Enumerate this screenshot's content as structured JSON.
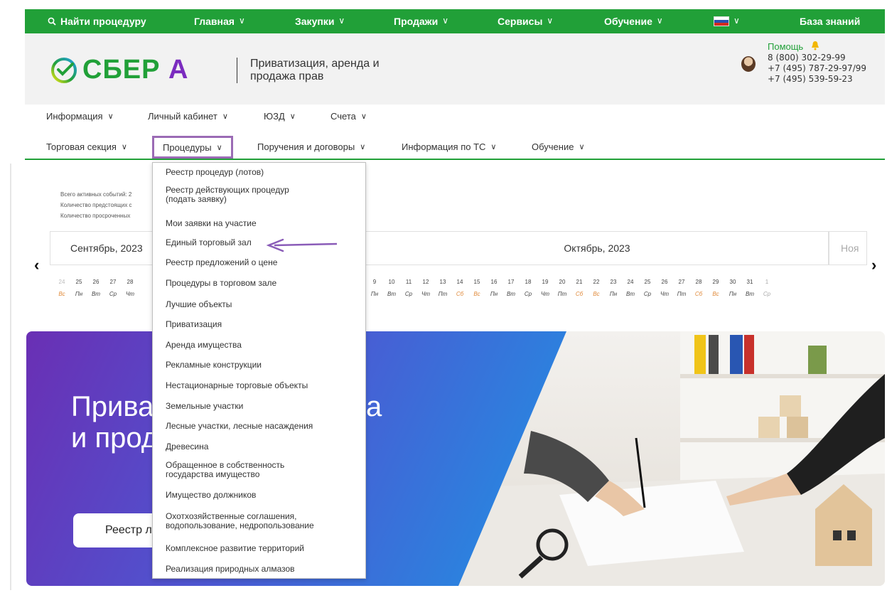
{
  "topbar": {
    "find_label": "Найти процедуру",
    "items": [
      "Главная",
      "Закупки",
      "Продажи",
      "Сервисы",
      "Обучение"
    ],
    "knowledge": "База знаний",
    "color": "#21a038"
  },
  "header": {
    "logo": "СБЕР",
    "logo_a": "А",
    "tagline_1": "Приватизация, аренда и",
    "tagline_2": "продажа прав",
    "help": {
      "label": "Помощь",
      "phone1": "8 (800) 302-29-99",
      "phone2": "+7 (495) 787-29-97/99",
      "phone3": "+7 (495) 539-59-23"
    }
  },
  "menu1": [
    "Информация",
    "Личный кабинет",
    "ЮЗД",
    "Счета"
  ],
  "menu2": [
    "Торговая секция",
    "Процедуры",
    "Поручения и договоры",
    "Информация по ТС",
    "Обучение"
  ],
  "events": {
    "line1": "Всего активных событий: 2",
    "line2": "Количество предстоящих с",
    "line3": "Количество просроченных"
  },
  "calendar": {
    "sept": "Сентябрь, 2023",
    "oct": "Октябрь, 2023",
    "nov": "Ноя",
    "left_days": [
      {
        "n": "24",
        "w": "Вс"
      },
      {
        "n": "25",
        "w": "Пн"
      },
      {
        "n": "26",
        "w": "Вт"
      },
      {
        "n": "27",
        "w": "Ср"
      },
      {
        "n": "28",
        "w": "Чт"
      }
    ],
    "right_days": [
      {
        "n": "9",
        "w": "Пн"
      },
      {
        "n": "10",
        "w": "Вт"
      },
      {
        "n": "11",
        "w": "Ср"
      },
      {
        "n": "12",
        "w": "Чт"
      },
      {
        "n": "13",
        "w": "Пт"
      },
      {
        "n": "14",
        "w": "Сб"
      },
      {
        "n": "15",
        "w": "Вс"
      },
      {
        "n": "16",
        "w": "Пн"
      },
      {
        "n": "17",
        "w": "Вт"
      },
      {
        "n": "18",
        "w": "Ср"
      },
      {
        "n": "19",
        "w": "Чт"
      },
      {
        "n": "20",
        "w": "Пт"
      },
      {
        "n": "21",
        "w": "Сб"
      },
      {
        "n": "22",
        "w": "Вс"
      },
      {
        "n": "23",
        "w": "Пн"
      },
      {
        "n": "24",
        "w": "Вт"
      },
      {
        "n": "25",
        "w": "Ср"
      },
      {
        "n": "26",
        "w": "Чт"
      },
      {
        "n": "27",
        "w": "Пт"
      },
      {
        "n": "28",
        "w": "Сб"
      },
      {
        "n": "29",
        "w": "Вс"
      },
      {
        "n": "30",
        "w": "Пн"
      },
      {
        "n": "31",
        "w": "Вт"
      },
      {
        "n": "1",
        "w": "Ср"
      }
    ]
  },
  "banner": {
    "title_1": "Прива",
    "title_2": "и прод",
    "title_right": "а",
    "button": "Реестр л"
  },
  "dropdown": [
    "Реестр процедур (лотов)",
    "Реестр действующих процедур\n(подать заявку)",
    "Мои заявки на участие",
    "Единый торговый зал",
    "Реестр предложений о цене",
    "Процедуры в торговом зале",
    "Лучшие объекты",
    "Приватизация",
    "Аренда имущества",
    "Рекламные конструкции",
    "Нестационарные торговые объекты",
    "Земельные участки",
    "Лесные участки, лесные насаждения",
    "Древесина",
    "Обращенное в собственность\nгосударства имущество",
    "Имущество должников",
    "Охотхозяйственные соглашения,\nводопользование, недропользование",
    "Комплексное развитие территорий",
    "Реализация природных алмазов"
  ]
}
